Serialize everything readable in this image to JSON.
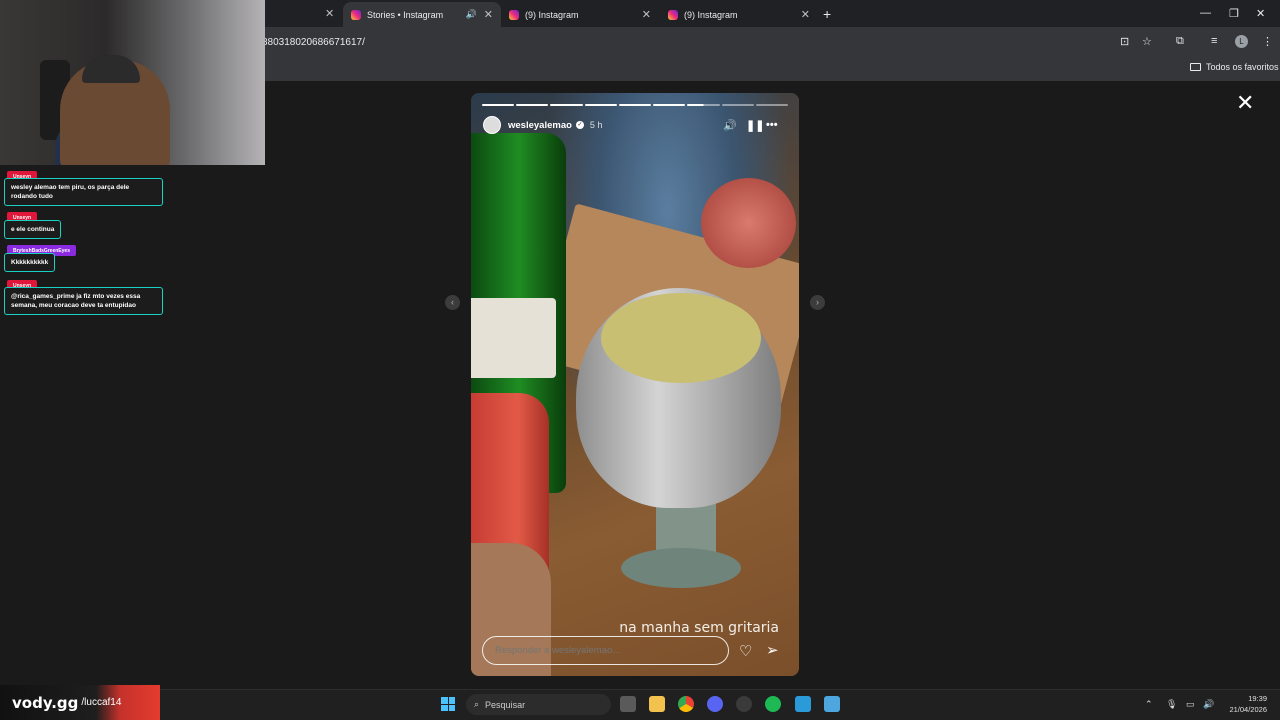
{
  "browser": {
    "tabs": [
      {
        "label": "Stories • Instagram",
        "active": true,
        "audio": true
      },
      {
        "label": "(9) Instagram",
        "active": false
      },
      {
        "label": "(9) Instagram",
        "active": false
      }
    ],
    "url": "880318020686671617/",
    "favorites_label": "Todos os favoritos",
    "profile_initial": "L"
  },
  "chat": {
    "messages": [
      {
        "user": "Unseyn",
        "text": "wesley alemao tem piru, os parça dele rodando tudo",
        "user_color": "#e0173b"
      },
      {
        "user": "Unseyn",
        "text": "e ele continua",
        "user_color": "#e0173b"
      },
      {
        "user": "BryteshBadsGreenEyes",
        "text": "Kkkkkkkkkk",
        "user_color": "#8a2be2"
      },
      {
        "user": "Unseyn",
        "text": "@rica_games_prime ja fiz mto vezes essa semana, meu coracao deve ta entupidao",
        "user_color": "#e0173b"
      }
    ]
  },
  "story": {
    "username": "wesleyalemao",
    "time": "5 h",
    "caption": "na manha sem gritaria",
    "reply_placeholder": "Responder a wesleyalemao...",
    "progress_segments": 9,
    "segments_done": 6,
    "current_segment_progress": 0.5
  },
  "overlay": {
    "brand": "vody.gg",
    "handle": "/luccaf14"
  },
  "taskbar": {
    "search_label": "Pesquisar",
    "time": "19:39",
    "date": "21/04/2026"
  },
  "colors": {
    "chat_border": "#19d2c3",
    "accent_brand": "#e53b2f"
  }
}
